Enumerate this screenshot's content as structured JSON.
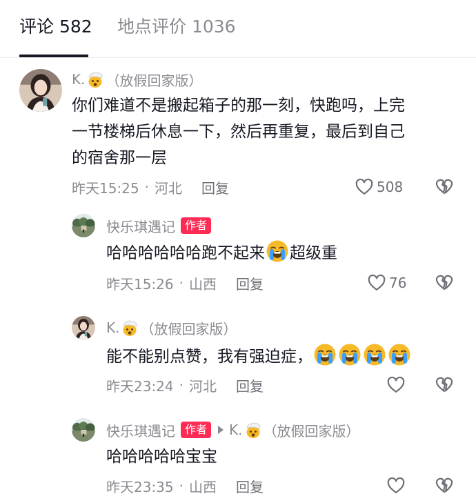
{
  "tabs": {
    "comments": "评论 582",
    "reviews": "地点评价 1036"
  },
  "comments": [
    {
      "author": "K.",
      "author_suffix": "（放假回家版）",
      "text_lines": [
        "你们难道不是搬起箱子的那一刻，快跑吗，上完",
        "一节楼梯后休息一下，然后再重复，最后到自己",
        "的宿舍那一层"
      ],
      "time": "昨天15:25",
      "separator": "·",
      "location": "河北",
      "reply_label": "回复",
      "likes": "508"
    },
    {
      "author": "快乐琪遇记",
      "badge": "作者",
      "text_before_emoji": "哈哈哈哈哈哈跑不起来",
      "text_after_emoji": "超级重",
      "time": "昨天15:26",
      "separator": "·",
      "location": "山西",
      "reply_label": "回复",
      "likes": "76"
    },
    {
      "author": "K.",
      "author_suffix": "（放假回家版）",
      "text": "能不能别点赞，我有强迫症，",
      "emoji_count": 4,
      "time": "昨天23:24",
      "separator": "·",
      "location": "河北",
      "reply_label": "回复",
      "likes": ""
    },
    {
      "author": "快乐琪遇记",
      "badge": "作者",
      "reply_to": "K.",
      "reply_to_suffix": "（放假回家版）",
      "text": "哈哈哈哈哈宝宝",
      "time": "昨天23:35",
      "separator": "·",
      "location": "山西",
      "reply_label": "回复",
      "likes": ""
    }
  ],
  "icons": {
    "like": "heart-outline-icon",
    "dislike": "broken-heart-icon",
    "author_emoji": "exploding-head-emoji-icon",
    "text_emoji": "loudly-crying-face-emoji-icon",
    "reply_to": "triangle-right-icon"
  },
  "colors": {
    "text": "#161823",
    "muted": "#8a8b91",
    "badge": "#fe2c55",
    "emoji_yellow": "#f7b928",
    "tears": "#3aa0ff"
  }
}
